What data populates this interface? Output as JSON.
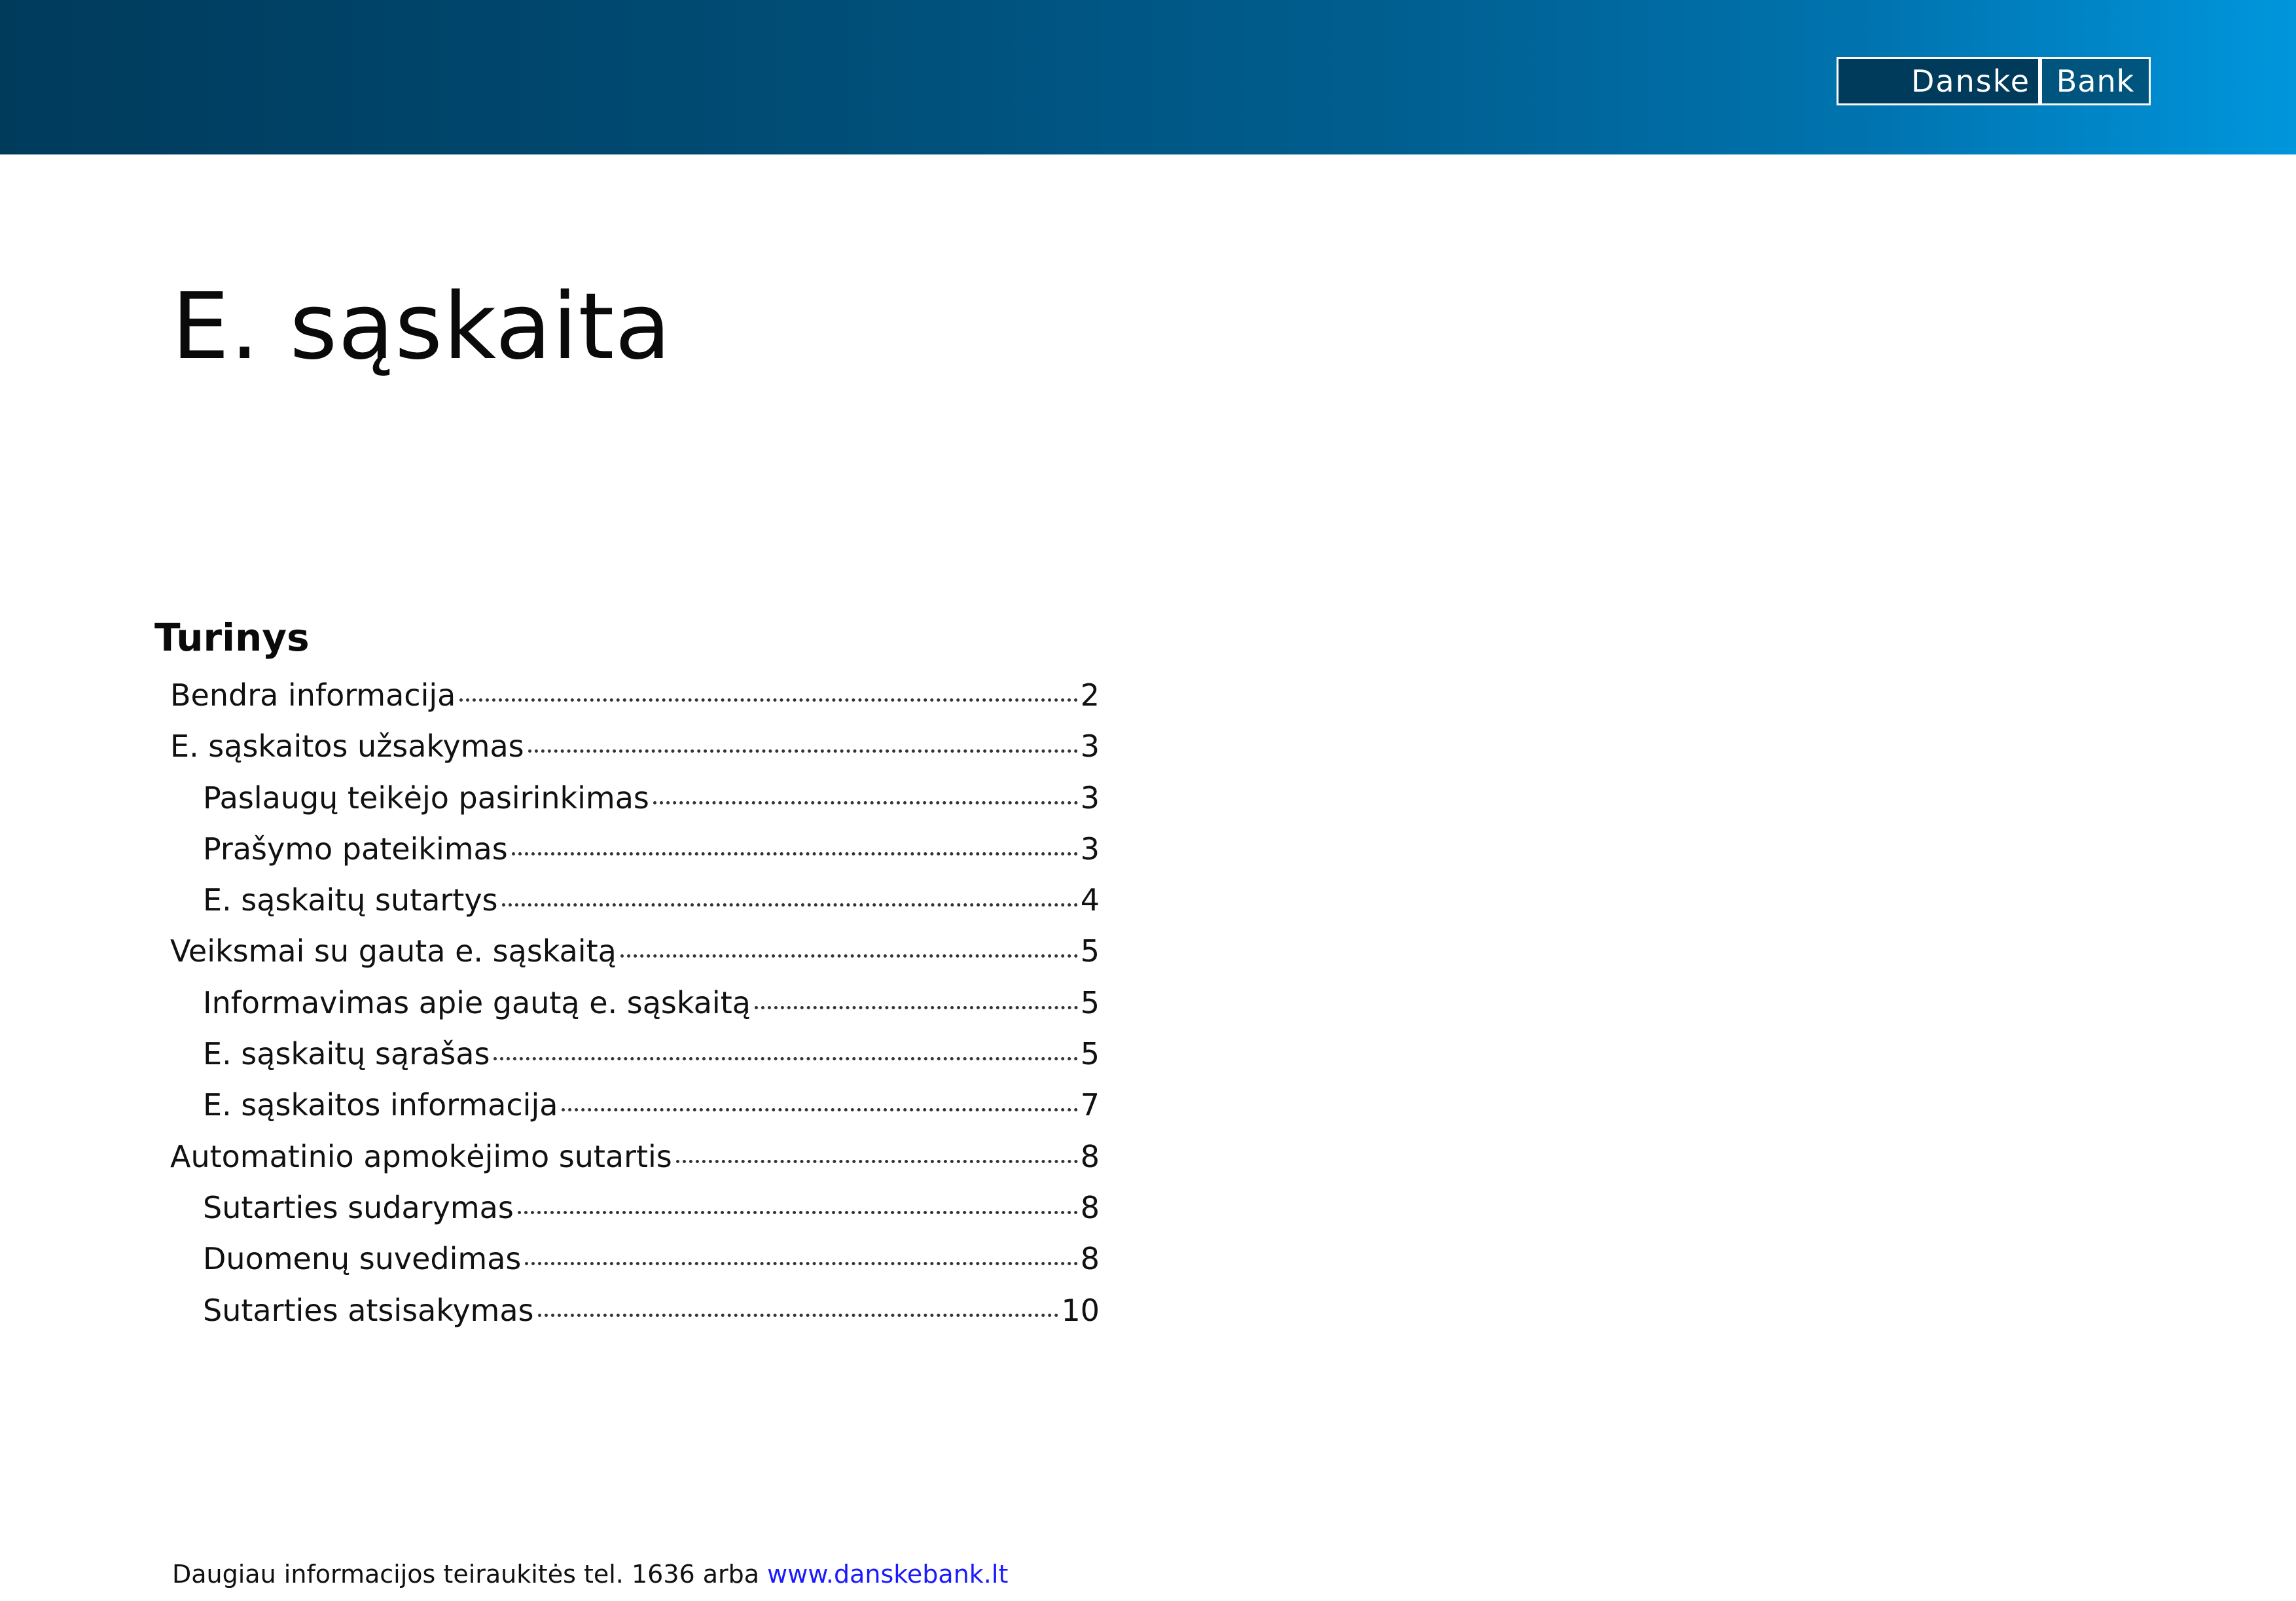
{
  "header": {
    "logo_left": "Danske",
    "logo_right": "Bank",
    "colors": {
      "band_dark": "#003b5c",
      "band_light": "#0096dc",
      "logo_dark": "#003b5c",
      "logo_mid": "#00557f"
    }
  },
  "document": {
    "title": "E. sąskaita"
  },
  "toc": {
    "heading": "Turinys",
    "items": [
      {
        "label": "Bendra informacija",
        "page": "2"
      },
      {
        "label": "E. sąskaitos užsakymas",
        "page": "3"
      },
      {
        "label": "Paslaugų teikėjo pasirinkimas",
        "page": "3"
      },
      {
        "label": "Prašymo pateikimas",
        "page": "3"
      },
      {
        "label": "E. sąskaitų sutartys",
        "page": "4"
      },
      {
        "label": "Veiksmai su gauta e. sąskaitą",
        "page": "5"
      },
      {
        "label": "Informavimas apie gautą e. sąskaitą",
        "page": "5"
      },
      {
        "label": "E. sąskaitų sąrašas",
        "page": "5"
      },
      {
        "label": "E. sąskaitos informacija",
        "page": "7"
      },
      {
        "label": "Automatinio apmokėjimo sutartis",
        "page": "8"
      },
      {
        "label": "Sutarties sudarymas",
        "page": "8"
      },
      {
        "label": "Duomenų suvedimas",
        "page": "8"
      },
      {
        "label": "Sutarties atsisakymas",
        "page": "10"
      }
    ]
  },
  "footer": {
    "text": "Daugiau informacijos teiraukitės tel. 1636 arba ",
    "link": "www.danskebank.lt",
    "link_color": "#1a1aff"
  }
}
